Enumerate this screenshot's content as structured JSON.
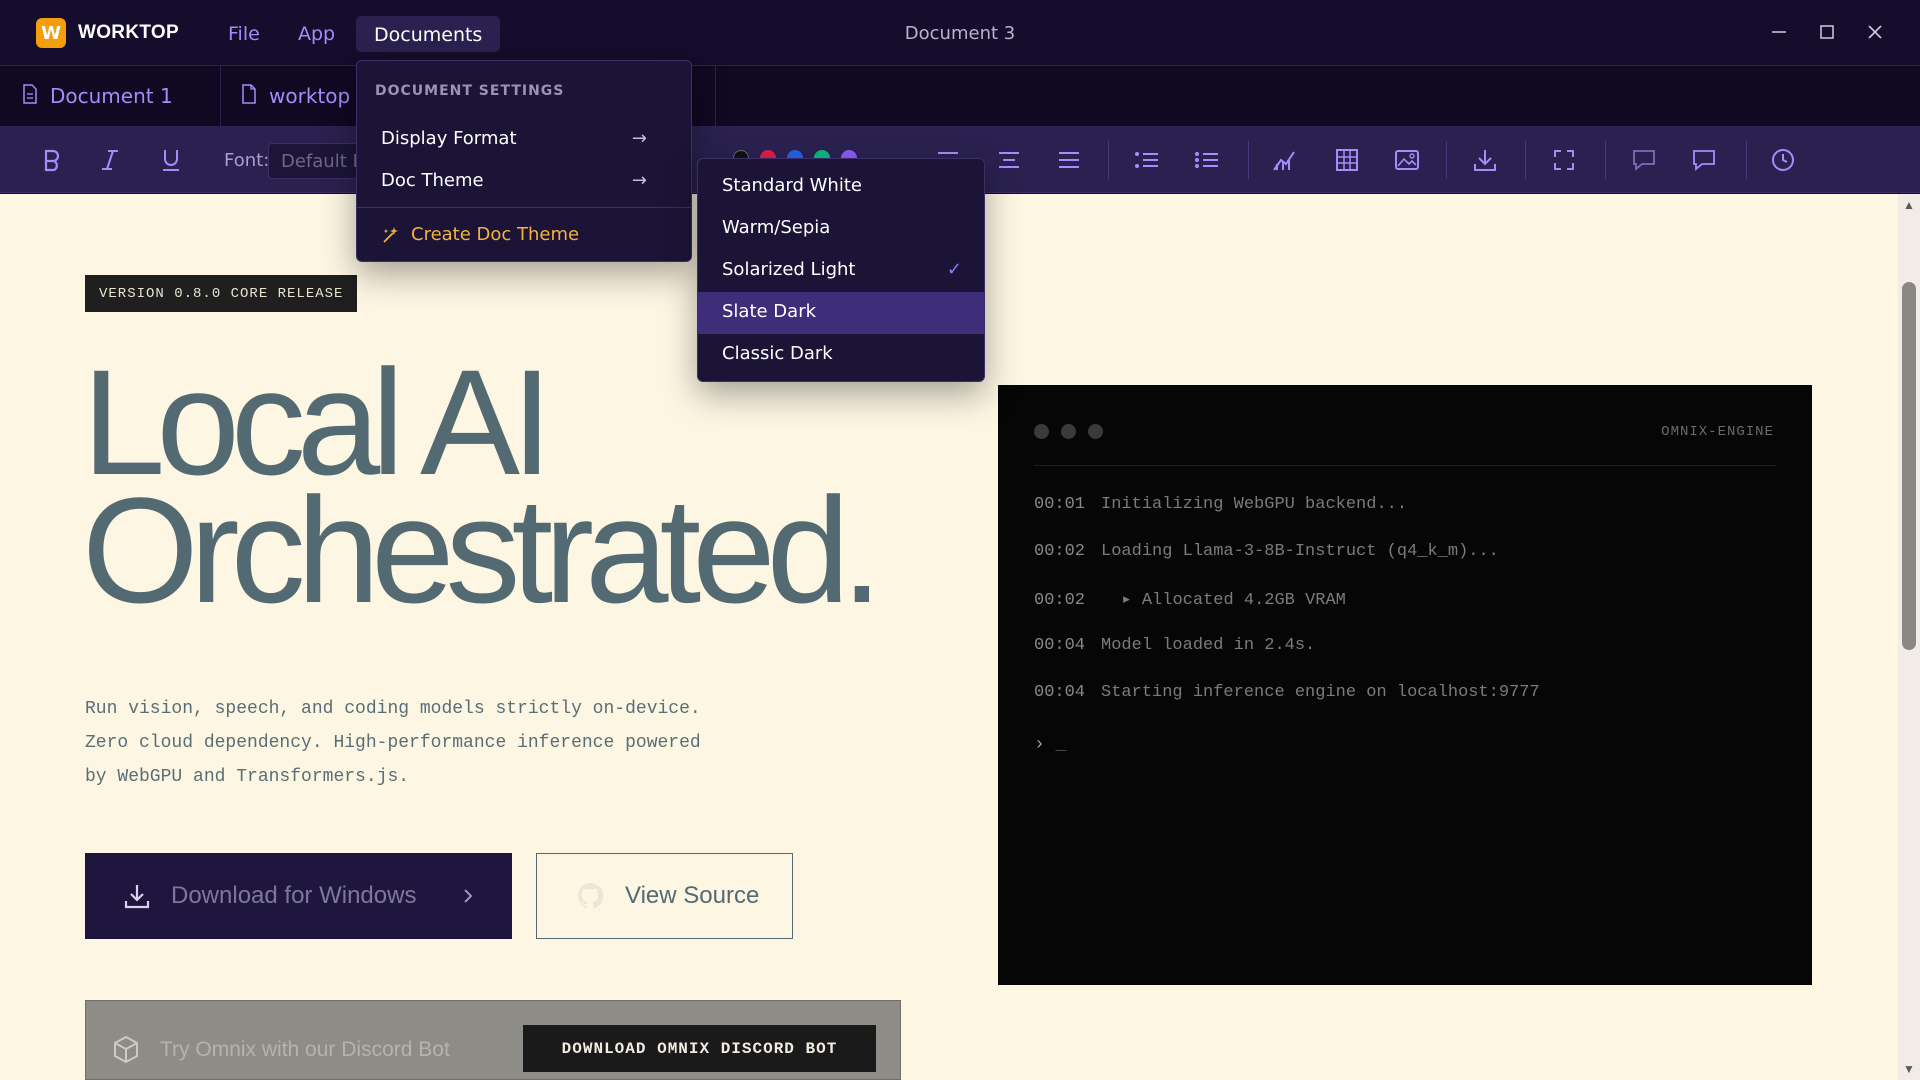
{
  "app": {
    "brand_letter": "W",
    "name": "WORKTOP",
    "document_title": "Document 3",
    "accent": "#a78bfa",
    "logo_color": "#f59e0b"
  },
  "menu": {
    "file": "File",
    "app": "App",
    "documents": "Documents"
  },
  "tabs": [
    {
      "label": "Document 1"
    },
    {
      "label": "worktop"
    }
  ],
  "toolbar": {
    "font_label": "Font:",
    "font_placeholder": "Default Font",
    "icons": [
      "bold-icon",
      "italic-icon",
      "underline-icon",
      "align-left-icon",
      "align-center-icon",
      "align-justify-icon",
      "bullet-list-icon",
      "numbered-list-icon",
      "chart-icon",
      "table-icon",
      "image-icon",
      "download-icon",
      "fullscreen-icon",
      "comment-icon",
      "comments-icon",
      "history-icon"
    ],
    "swatches": [
      "#111111",
      "#e11d48",
      "#2563eb",
      "#10b981",
      "#8b5cf6"
    ]
  },
  "documents_menu": {
    "header": "DOCUMENT SETTINGS",
    "items": [
      {
        "label": "Display Format",
        "arrow": "→"
      },
      {
        "label": "Doc Theme",
        "arrow": "→"
      }
    ],
    "create": "Create Doc Theme"
  },
  "theme_menu": {
    "items": [
      {
        "label": "Standard White"
      },
      {
        "label": "Warm/Sepia"
      },
      {
        "label": "Solarized Light",
        "checked": true,
        "check": "✓"
      },
      {
        "label": "Slate Dark",
        "highlighted": true
      },
      {
        "label": "Classic Dark"
      }
    ]
  },
  "page": {
    "badge": "VERSION 0.8.0 CORE RELEASE",
    "hero_line1": "Local AI",
    "hero_line2": "Orchestrated.",
    "desc_line1": "Run vision, speech, and coding models strictly on-device.",
    "desc_line2": "Zero cloud dependency. High-performance inference powered",
    "desc_line3": "by WebGPU and Transformers.js.",
    "download_button": "Download for Windows",
    "source_button": "View Source",
    "discord_text": "Try Omnix with our Discord Bot",
    "discord_button": "DOWNLOAD OMNIX DISCORD BOT"
  },
  "terminal": {
    "title": "OMNIX-ENGINE",
    "lines": [
      {
        "time": "00:01",
        "text": "Initializing WebGPU backend..."
      },
      {
        "time": "00:02",
        "text": "Loading Llama-3-8B-Instruct (q4_k_m)..."
      },
      {
        "time": "00:02",
        "text": "  ▸ Allocated 4.2GB VRAM"
      },
      {
        "time": "00:04",
        "text": "Model loaded in 2.4s."
      },
      {
        "time": "00:04",
        "text": "Starting inference engine on localhost:9777"
      }
    ],
    "prompt": "›",
    "cursor": "_"
  }
}
